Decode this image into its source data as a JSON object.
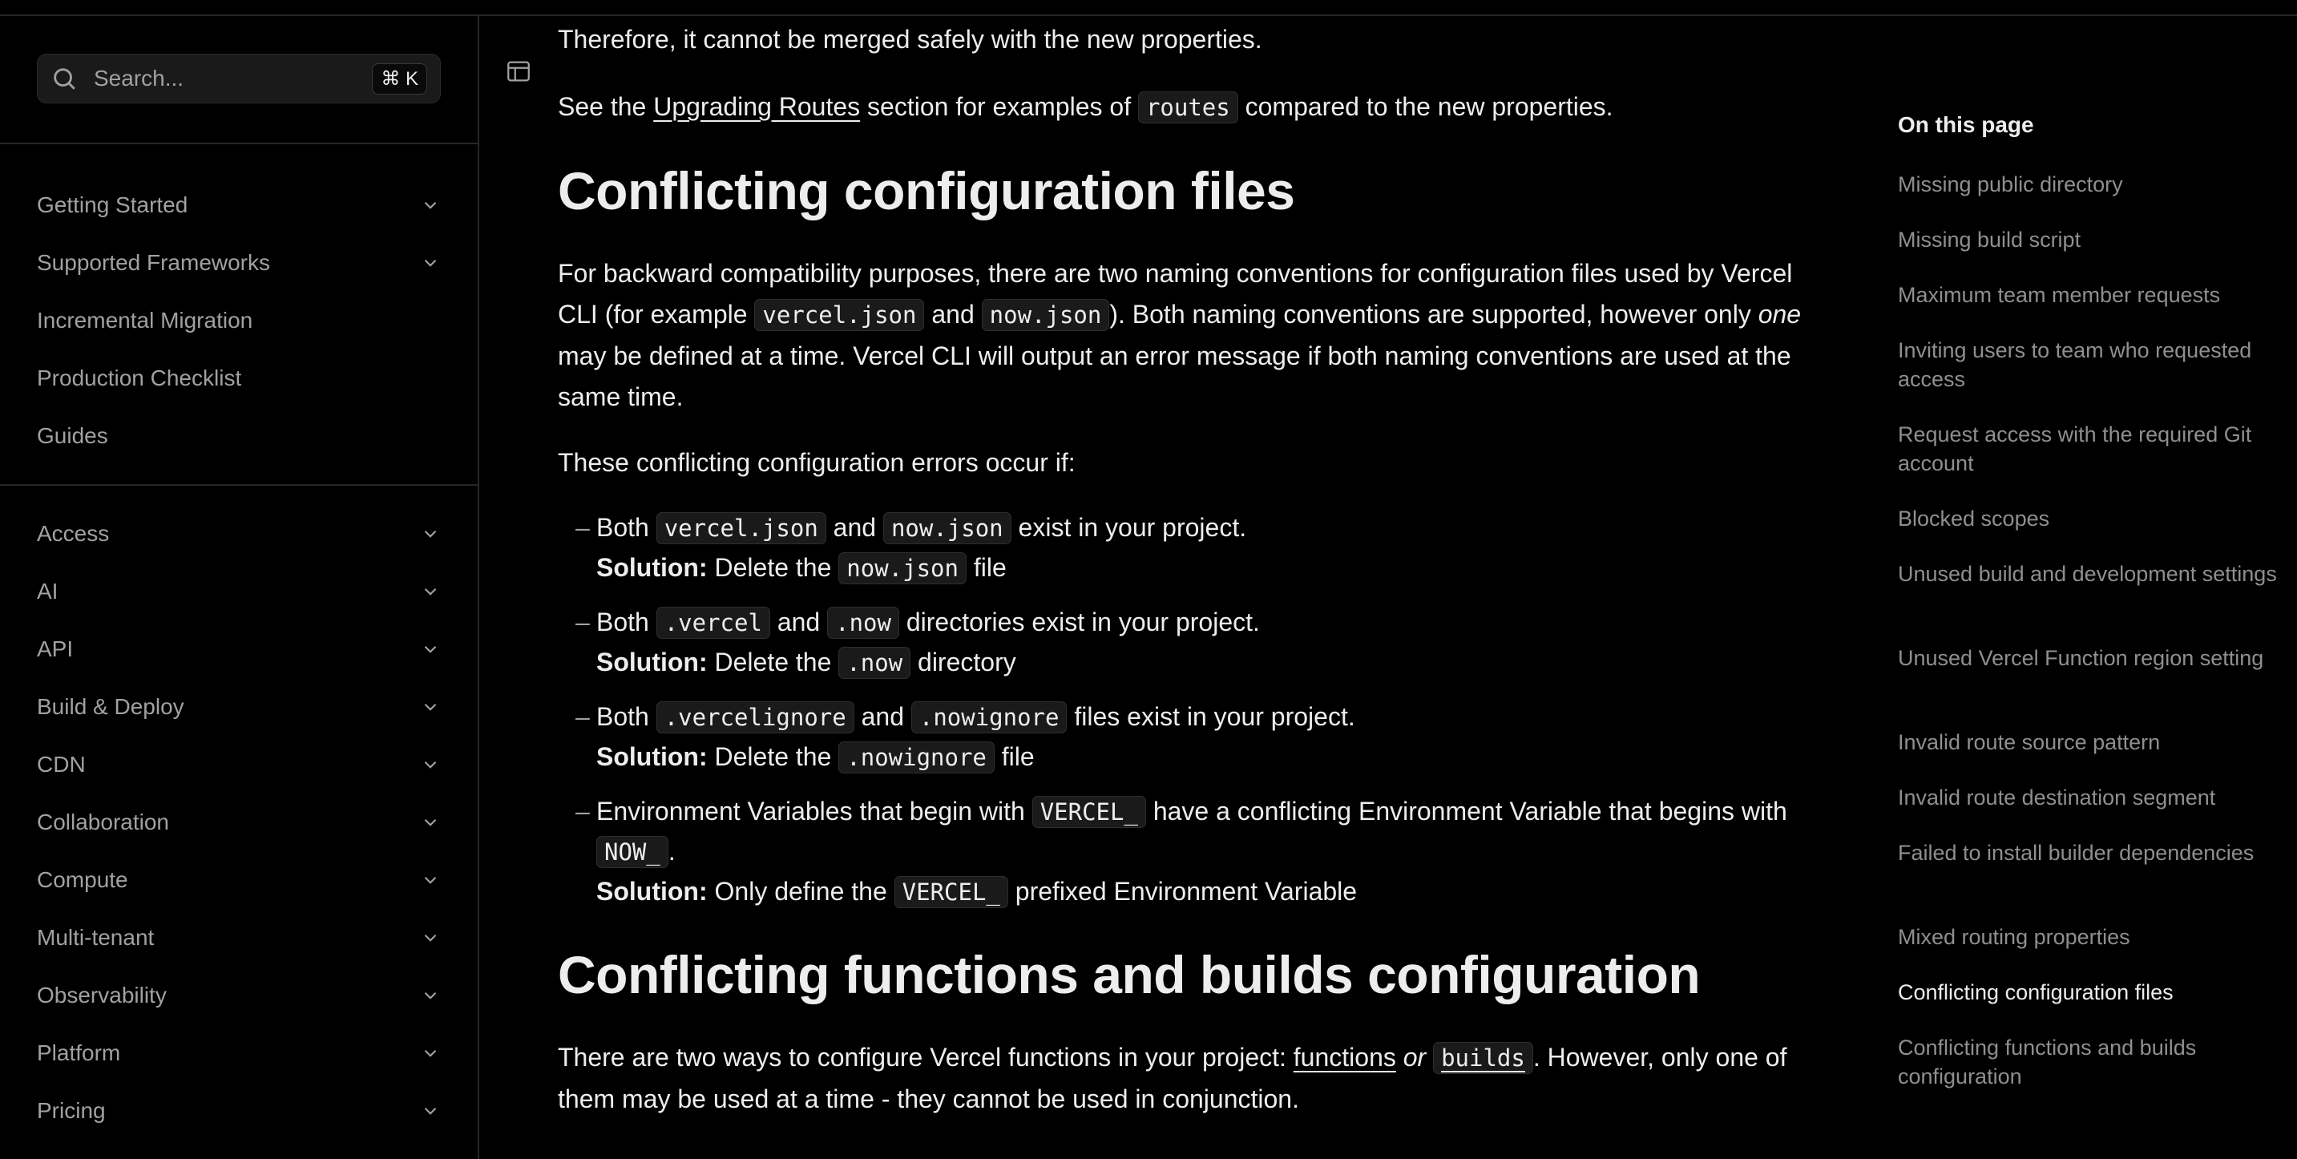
{
  "search": {
    "placeholder": "Search...",
    "shortcut": "⌘ K"
  },
  "sidebar": {
    "top_items": [
      {
        "label": "Getting Started",
        "expandable": true
      },
      {
        "label": "Supported Frameworks",
        "expandable": true
      },
      {
        "label": "Incremental Migration",
        "expandable": false
      },
      {
        "label": "Production Checklist",
        "expandable": false
      },
      {
        "label": "Guides",
        "expandable": false
      }
    ],
    "items": [
      {
        "label": "Access"
      },
      {
        "label": "AI"
      },
      {
        "label": "API"
      },
      {
        "label": "Build & Deploy"
      },
      {
        "label": "CDN"
      },
      {
        "label": "Collaboration"
      },
      {
        "label": "Compute"
      },
      {
        "label": "Multi-tenant"
      },
      {
        "label": "Observability"
      },
      {
        "label": "Platform"
      },
      {
        "label": "Pricing"
      }
    ]
  },
  "content": {
    "p_merged": "Therefore, it cannot be merged safely with the new properties.",
    "see": {
      "pre": "See the ",
      "link": "Upgrading Routes",
      "mid": " section for examples of ",
      "code": "routes",
      "post": " compared to the new properties."
    },
    "h_conflicting_files": "Conflicting configuration files",
    "compat": {
      "t1": "For backward compatibility purposes, there are two naming conventions for configuration files used by Vercel CLI (for example ",
      "c1": "vercel.json",
      "t2": " and ",
      "c2": "now.json",
      "t3": "). Both naming conventions are supported, however only ",
      "em": "one",
      "t4": " may be defined at a time. Vercel CLI will output an error message if both naming conventions are used at the same time."
    },
    "errors_intro": "These conflicting configuration errors occur if:",
    "dash": "–",
    "solution_label": "Solution:",
    "list": [
      {
        "pre": "Both ",
        "c1": "vercel.json",
        "mid": " and ",
        "c2": "now.json",
        "post": " exist in your project.",
        "sol_pre": " Delete the ",
        "sol_code": "now.json",
        "sol_post": " file"
      },
      {
        "pre": "Both ",
        "c1": ".vercel",
        "mid": " and ",
        "c2": ".now",
        "post": " directories exist in your project.",
        "sol_pre": " Delete the ",
        "sol_code": ".now",
        "sol_post": " directory"
      },
      {
        "pre": "Both ",
        "c1": ".vercelignore",
        "mid": " and ",
        "c2": ".nowignore",
        "post": " files exist in your project.",
        "sol_pre": " Delete the ",
        "sol_code": ".nowignore",
        "sol_post": " file"
      },
      {
        "pre": "Environment Variables that begin with ",
        "c1": "VERCEL_",
        "mid": " have a conflicting Environment Variable that begins with ",
        "c2": "NOW_",
        "post": ".",
        "sol_pre": " Only define the ",
        "sol_code": "VERCEL_",
        "sol_post": " prefixed Environment Variable"
      }
    ],
    "h_functions_builds": "Conflicting functions and builds configuration",
    "ways": {
      "pre": "There are two ways to configure Vercel functions in your project: ",
      "link1": "functions",
      "or": " or ",
      "link2": "builds",
      "post": ". However, only one of them may be used at a time - they cannot be used in conjunction."
    }
  },
  "toc": {
    "title": "On this page",
    "items": [
      {
        "label": "Missing public directory",
        "active": false
      },
      {
        "label": "Missing build script",
        "active": false
      },
      {
        "label": "Maximum team member requests",
        "active": false
      },
      {
        "label": "Inviting users to team who requested access",
        "active": false
      },
      {
        "label": "Request access with the required Git account",
        "active": false
      },
      {
        "label": "Blocked scopes",
        "active": false
      },
      {
        "label": "Unused build and development settings",
        "active": false
      },
      {
        "label": "Unused Vercel Function region setting",
        "active": false
      },
      {
        "label": "Invalid route source pattern",
        "active": false
      },
      {
        "label": "Invalid route destination segment",
        "active": false
      },
      {
        "label": "Failed to install builder dependencies",
        "active": false
      },
      {
        "label": "Mixed routing properties",
        "active": false
      },
      {
        "label": "Conflicting configuration files",
        "active": true
      },
      {
        "label": "Conflicting functions and builds configuration",
        "active": false
      }
    ]
  }
}
